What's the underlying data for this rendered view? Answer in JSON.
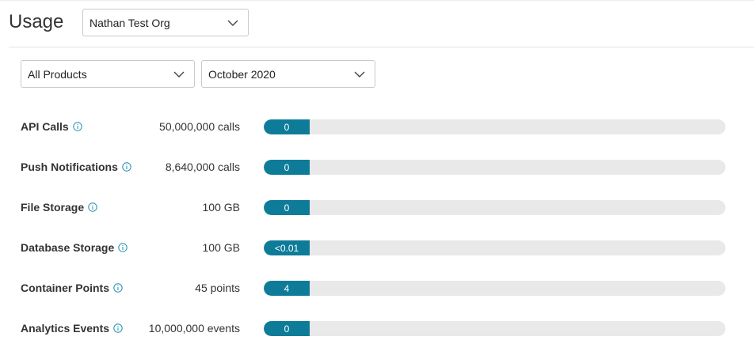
{
  "header": {
    "title": "Usage",
    "org_select": {
      "value": "Nathan Test Org",
      "icon": "chevron-down-icon"
    }
  },
  "filters": {
    "product": {
      "value": "All Products",
      "icon": "chevron-down-icon"
    },
    "month": {
      "value": "October 2020",
      "icon": "chevron-down-icon"
    }
  },
  "colors": {
    "accent": "#0e7c99",
    "track": "#e9e9e9",
    "info_icon": "#1b8fb0"
  },
  "metrics": [
    {
      "label": "API Calls",
      "limit": "50,000,000 calls",
      "value": "0",
      "icon": "info-icon"
    },
    {
      "label": "Push Notifications",
      "limit": "8,640,000 calls",
      "value": "0",
      "icon": "info-icon"
    },
    {
      "label": "File Storage",
      "limit": "100 GB",
      "value": "0",
      "icon": "info-icon"
    },
    {
      "label": "Database Storage",
      "limit": "100 GB",
      "value": "<0.01",
      "icon": "info-icon"
    },
    {
      "label": "Container Points",
      "limit": "45 points",
      "value": "4",
      "icon": "info-icon"
    },
    {
      "label": "Analytics Events",
      "limit": "10,000,000 events",
      "value": "0",
      "icon": "info-icon"
    }
  ]
}
